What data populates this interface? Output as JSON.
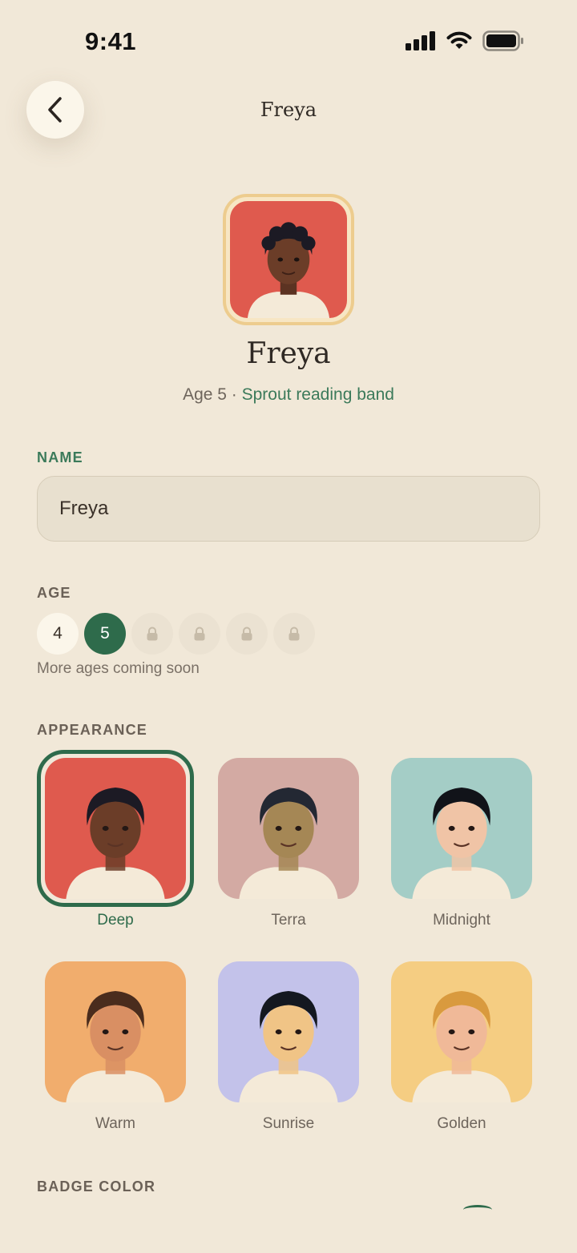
{
  "status_bar": {
    "time": "9:41"
  },
  "header": {
    "title": "Freya"
  },
  "profile": {
    "name": "Freya",
    "age_text": "Age 5 · ",
    "reading_band": "Sprout reading band"
  },
  "name_section": {
    "label": "NAME",
    "value": "Freya"
  },
  "age_section": {
    "label": "AGE",
    "options": [
      "4",
      "5"
    ],
    "selected": "5",
    "locked_count": 4,
    "note": "More ages coming soon"
  },
  "appearance_section": {
    "label": "APPEARANCE",
    "selected": "Deep",
    "options": [
      {
        "label": "Deep",
        "bg": "#df5a4e",
        "skin": "#6b3d28",
        "hair": "#1c1a24"
      },
      {
        "label": "Terra",
        "bg": "#d3aaa3",
        "skin": "#a58755",
        "hair": "#232833"
      },
      {
        "label": "Midnight",
        "bg": "#a4cdc6",
        "skin": "#f0c4a6",
        "hair": "#111319"
      },
      {
        "label": "Warm",
        "bg": "#f1ad6d",
        "skin": "#d98f63",
        "hair": "#4a2c1d"
      },
      {
        "label": "Sunrise",
        "bg": "#c3c2ea",
        "skin": "#f0c486",
        "hair": "#141820"
      },
      {
        "label": "Golden",
        "bg": "#f5cd82",
        "skin": "#f0b998",
        "hair": "#d99a3e"
      }
    ]
  },
  "badge_section": {
    "label": "BADGE COLOR"
  }
}
